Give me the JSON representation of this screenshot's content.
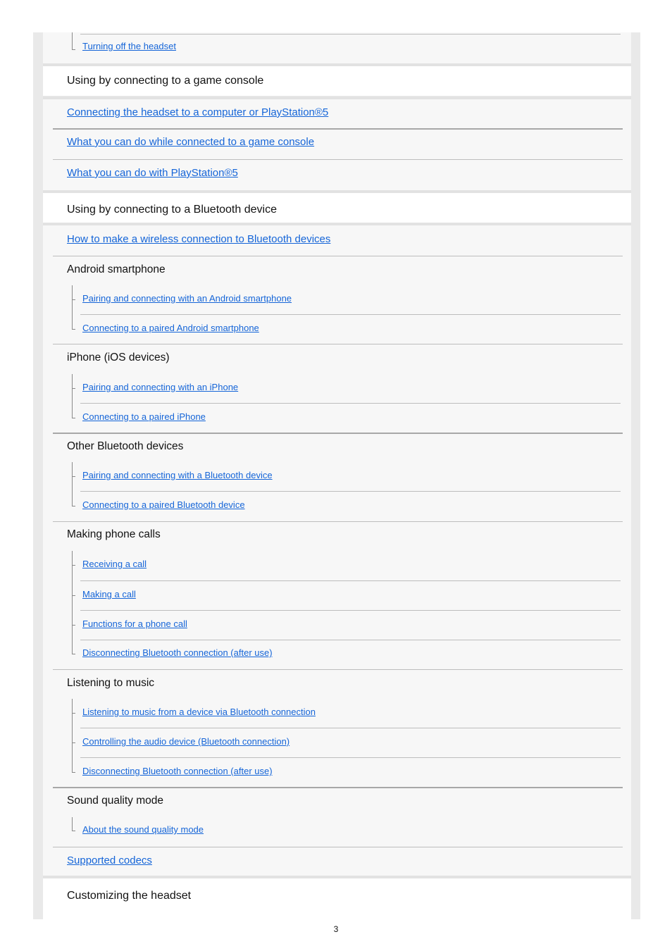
{
  "top": {
    "link": "Turning off the headset"
  },
  "sections": [
    {
      "title": "Using by connecting to a game console",
      "links": [
        "Connecting the headset to a computer or PlayStation®5",
        "What you can do while connected to a game console",
        "What you can do with PlayStation®5"
      ]
    },
    {
      "title": "Using by connecting to a Bluetooth device",
      "link": "How to make a wireless connection to Bluetooth devices",
      "groups": [
        {
          "title": "Android smartphone",
          "links": [
            "Pairing and connecting with an Android smartphone",
            "Connecting to a paired Android smartphone"
          ]
        },
        {
          "title": "iPhone (iOS devices)",
          "links": [
            "Pairing and connecting with an iPhone",
            "Connecting to a paired iPhone"
          ]
        },
        {
          "title": "Other Bluetooth devices",
          "links": [
            "Pairing and connecting with a Bluetooth device",
            "Connecting to a paired Bluetooth device"
          ]
        },
        {
          "title": "Making phone calls",
          "links": [
            "Receiving a call",
            "Making a call",
            "Functions for a phone call",
            "Disconnecting Bluetooth connection (after use)"
          ]
        },
        {
          "title": "Listening to music",
          "links": [
            "Listening to music from a device via Bluetooth connection",
            "Controlling the audio device (Bluetooth connection)",
            "Disconnecting Bluetooth connection (after use)"
          ]
        },
        {
          "title": "Sound quality mode",
          "links": [
            "About the sound quality mode"
          ]
        }
      ],
      "end_link": "Supported codecs"
    },
    {
      "title": "Customizing the headset"
    }
  ],
  "page_number": "3",
  "colors": {
    "link": "#1565d8",
    "panel": "#f7f7f7",
    "frame": "#e9e9e9"
  }
}
